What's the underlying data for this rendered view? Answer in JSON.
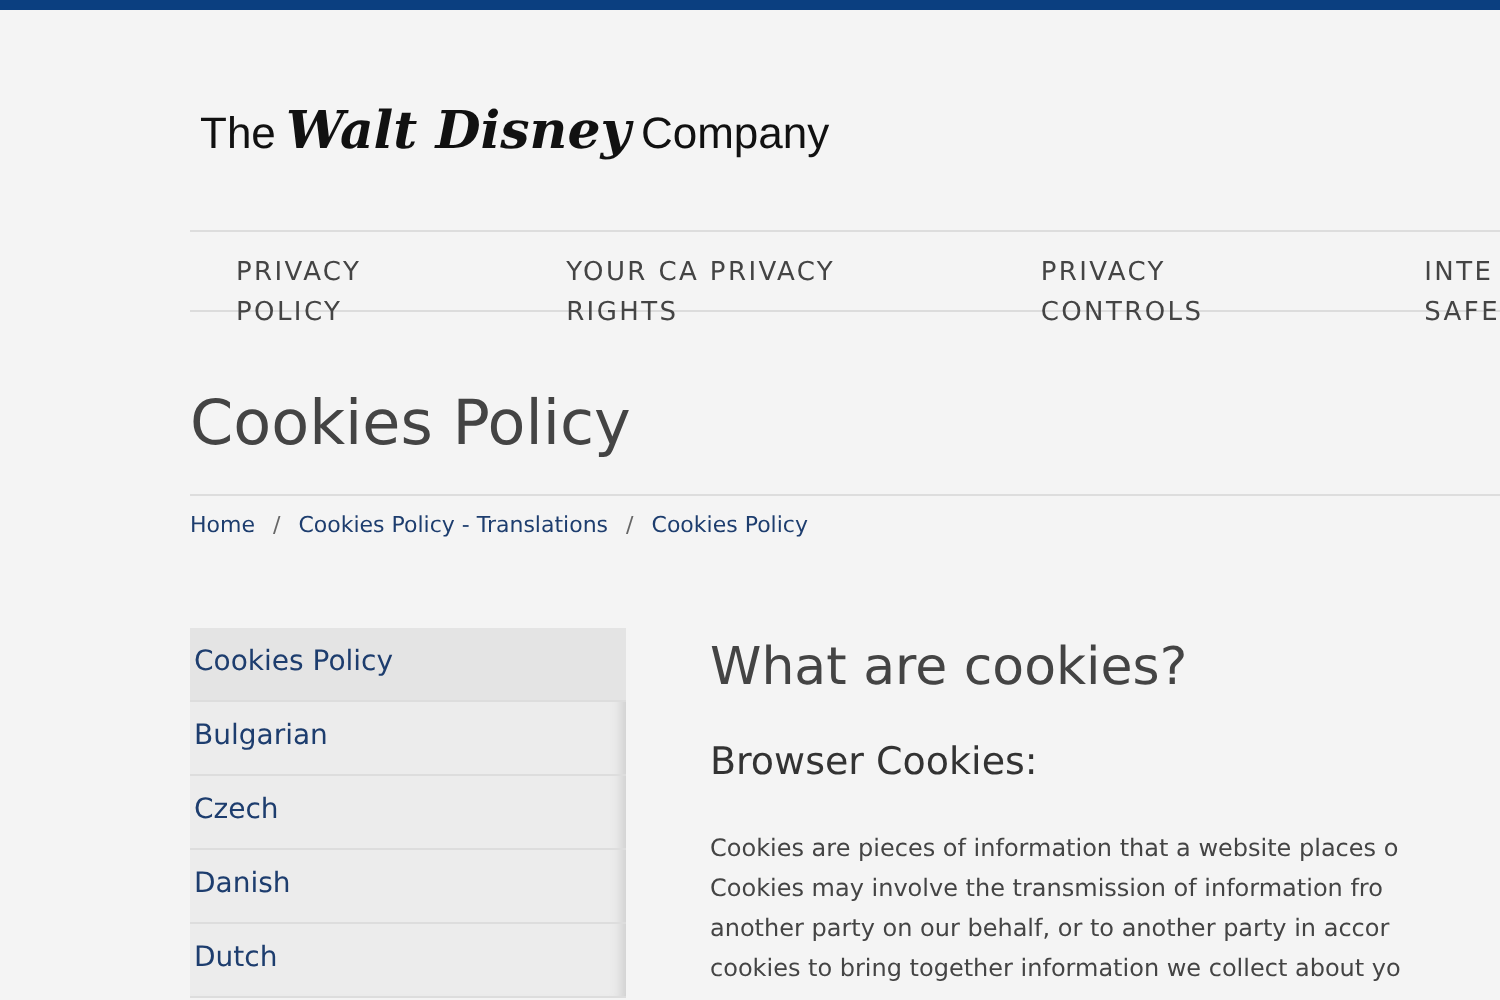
{
  "logo": {
    "prefix": "The",
    "script": "Walt Disney",
    "suffix": "Company"
  },
  "nav": [
    {
      "lines": [
        "PRIVACY",
        "POLICY"
      ]
    },
    {
      "lines": [
        "YOUR CA PRIVACY",
        "RIGHTS"
      ]
    },
    {
      "lines": [
        "PRIVACY",
        "CONTROLS"
      ]
    },
    {
      "lines": [
        "INTE",
        "SAFE"
      ]
    }
  ],
  "page_title": "Cookies Policy",
  "breadcrumb": {
    "items": [
      "Home",
      "Cookies Policy - Translations",
      "Cookies Policy"
    ],
    "separators": [
      "/",
      "/"
    ]
  },
  "sidebar": {
    "items": [
      {
        "label": "Cookies Policy",
        "selected": true
      },
      {
        "label": "Bulgarian",
        "selected": false
      },
      {
        "label": "Czech",
        "selected": false
      },
      {
        "label": "Danish",
        "selected": false
      },
      {
        "label": "Dutch",
        "selected": false
      }
    ]
  },
  "content": {
    "heading": "What are cookies?",
    "subheading": "Browser Cookies:",
    "lines": [
      "Cookies are pieces of information that a website places o",
      "Cookies may involve the transmission of information fro",
      "another party on our behalf, or to another party in accor",
      "cookies to bring together information we collect about yo"
    ]
  }
}
